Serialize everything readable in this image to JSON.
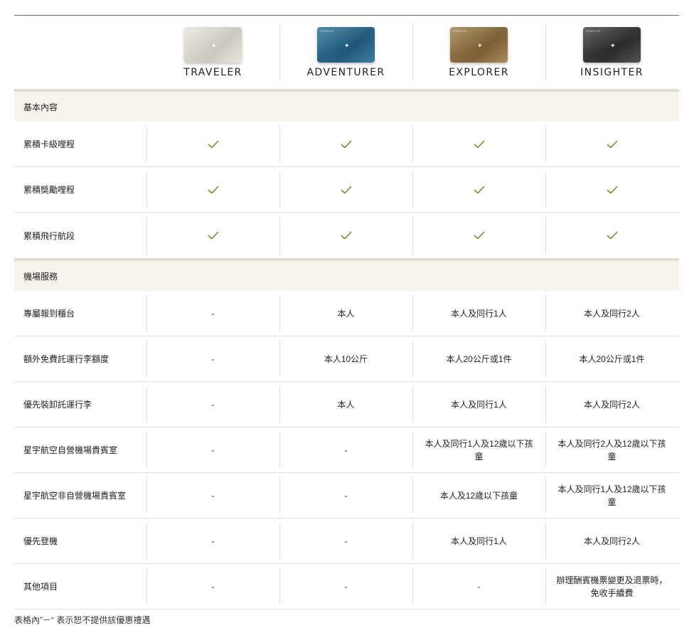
{
  "tiers": [
    {
      "name": "TRAVELER",
      "card_color": "#c9c7bf",
      "card_color2": "#e6e4dc",
      "brand": "STARLUX"
    },
    {
      "name": "ADVENTURER",
      "card_color": "#1f5677",
      "card_color2": "#2e7498",
      "brand": "STARLUX"
    },
    {
      "name": "EXPLORER",
      "card_color": "#7a5d33",
      "card_color2": "#a0824f",
      "brand": "STARLUX"
    },
    {
      "name": "INSIGHTER",
      "card_color": "#2a2a2a",
      "card_color2": "#444444",
      "brand": "STARLUX"
    }
  ],
  "check_color": "#6d8f2e",
  "sections": [
    {
      "title": "基本內容",
      "rows": [
        {
          "label": "累積卡級哩程",
          "values": [
            "check",
            "check",
            "check",
            "check"
          ]
        },
        {
          "label": "累積獎勵哩程",
          "values": [
            "check",
            "check",
            "check",
            "check"
          ]
        },
        {
          "label": "累積飛行航段",
          "values": [
            "check",
            "check",
            "check",
            "check"
          ]
        }
      ]
    },
    {
      "title": "機場服務",
      "rows": [
        {
          "label": "專屬報到櫃台",
          "values": [
            "-",
            "本人",
            "本人及同行1人",
            "本人及同行2人"
          ]
        },
        {
          "label": "額外免費託運行李額度",
          "values": [
            "-",
            "本人10公斤",
            "本人20公斤或1件",
            "本人20公斤或1件"
          ]
        },
        {
          "label": "優先裝卸託運行李",
          "values": [
            "-",
            "本人",
            "本人及同行1人",
            "本人及同行2人"
          ]
        },
        {
          "label": "星宇航空自營機場貴賓室",
          "values": [
            "-",
            "-",
            "本人及同行1人及12歲以下孩童",
            "本人及同行2人及12歲以下孩童"
          ]
        },
        {
          "label": "星宇航空非自營機場貴賓室",
          "values": [
            "-",
            "-",
            "本人及12歲以下孩童",
            "本人及同行1人及12歲以下孩童"
          ]
        },
        {
          "label": "優先登機",
          "values": [
            "-",
            "-",
            "本人及同行1人",
            "本人及同行2人"
          ]
        },
        {
          "label": "其他項目",
          "values": [
            "-",
            "-",
            "-",
            "辦理酬賓機票變更及退票時，免收手續費"
          ]
        }
      ]
    }
  ],
  "footnote": "表格內”－“ 表示恕不提供該優惠禮遇"
}
